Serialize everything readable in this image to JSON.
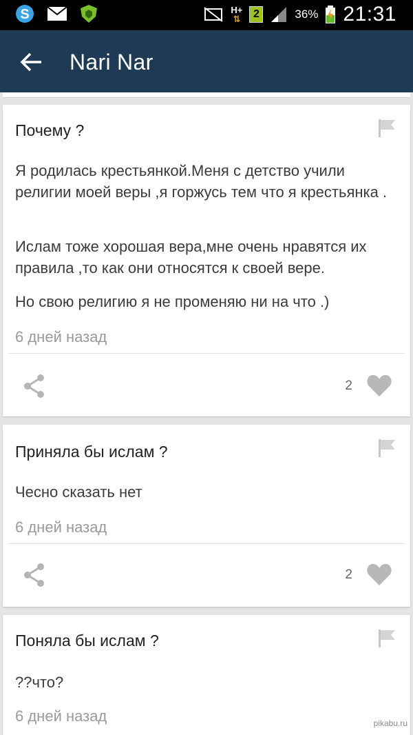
{
  "status_bar": {
    "network": "H+",
    "sim_badge": "2",
    "battery_percent": "36%",
    "time": "21:31"
  },
  "app_bar": {
    "title": "Nari Nar"
  },
  "cards": [
    {
      "question": "Почему ?",
      "paragraphs": [
        "Я родилась крестьянкой.Меня с детство учили религии моей веры ,я горжусь тем что я крестьянка .",
        "Ислам тоже хорошая вера,мне очень нравятся их правила ,то как они относятся к своей вере.",
        "Но свою религию я не променяю ни на что .)"
      ],
      "time": "6 дней назад",
      "likes": "2"
    },
    {
      "question": "Приняла бы ислам ?",
      "paragraphs": [
        "Чесно сказать нет"
      ],
      "time": "6 дней назад",
      "likes": "2"
    },
    {
      "question": "Поняла бы ислам ?",
      "paragraphs": [
        "??что?"
      ],
      "time": "6 дней назад"
    }
  ],
  "watermark": "pikabu.ru"
}
